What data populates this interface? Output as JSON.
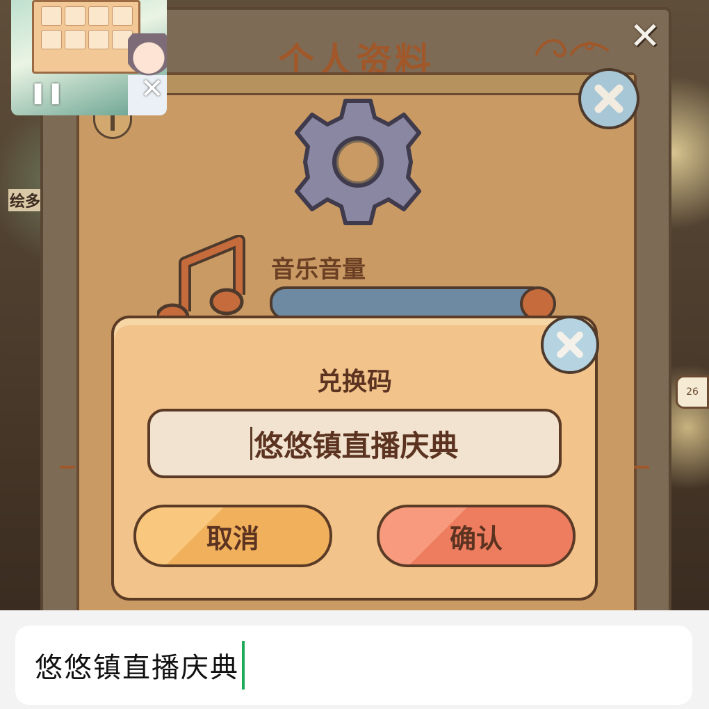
{
  "background_game": {
    "side_label": "绘多",
    "side_badge": "26"
  },
  "profile_panel": {
    "title": "个人资料",
    "close_icon": "close-icon",
    "settings_icon": "gear-icon",
    "music": {
      "label": "音乐音量",
      "icon": "music-note-icon",
      "level": 0.93
    }
  },
  "mini_window": {
    "pause_icon": "pause-icon",
    "close_icon": "close-icon"
  },
  "redeem_dialog": {
    "title": "兑换码",
    "input_value": "悠悠镇直播庆典",
    "cancel_label": "取消",
    "confirm_label": "确认"
  },
  "ime_bar": {
    "text": "悠悠镇直播庆典",
    "caret_color": "#1faa59"
  },
  "colors": {
    "dialog_bg": "#f2c38a",
    "cancel_button": "#f0b05c",
    "confirm_button": "#ee7c5e",
    "title_brown": "#a0582b"
  }
}
